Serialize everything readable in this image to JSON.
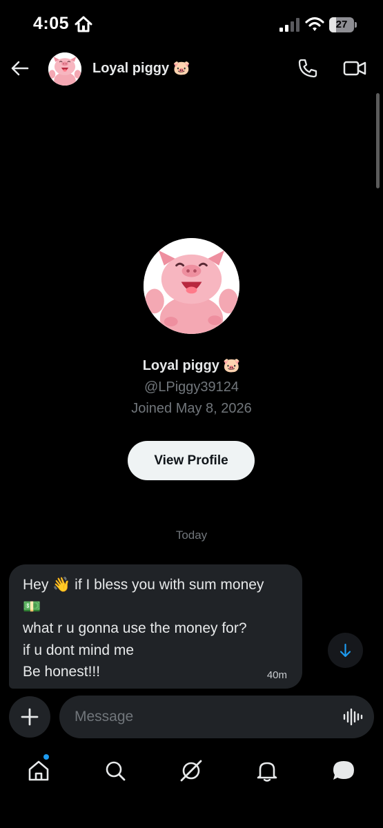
{
  "status_bar": {
    "time": "4:05",
    "battery": "27",
    "battery_level": 0.27
  },
  "header": {
    "name": "Loyal piggy",
    "name_emoji": "🐷"
  },
  "profile": {
    "name": "Loyal piggy",
    "name_emoji": "🐷",
    "handle": "@LPiggy39124",
    "joined": "Joined May 8, 2026",
    "view_profile_label": "View Profile"
  },
  "conversation": {
    "date_divider": "Today",
    "message": {
      "lines": [
        "Hey 👋 if I bless you with sum money",
        "💵",
        "what r u gonna use the money for?",
        "if u dont mind me",
        "Be honest!!!"
      ],
      "time": "40m"
    }
  },
  "composer": {
    "placeholder": "Message"
  },
  "colors": {
    "accent": "#1d9bf0",
    "background": "#000000",
    "bubble": "#202327",
    "muted": "#71767b"
  },
  "icons": {
    "status": [
      "home-icon",
      "signal-icon",
      "wifi-icon",
      "battery-icon"
    ],
    "header": [
      "back-arrow-icon",
      "phone-icon",
      "video-icon"
    ],
    "composer": [
      "plus-icon",
      "voice-waveform-icon"
    ],
    "tabs": [
      "home-icon",
      "search-icon",
      "grok-icon",
      "bell-icon",
      "messages-icon"
    ]
  }
}
